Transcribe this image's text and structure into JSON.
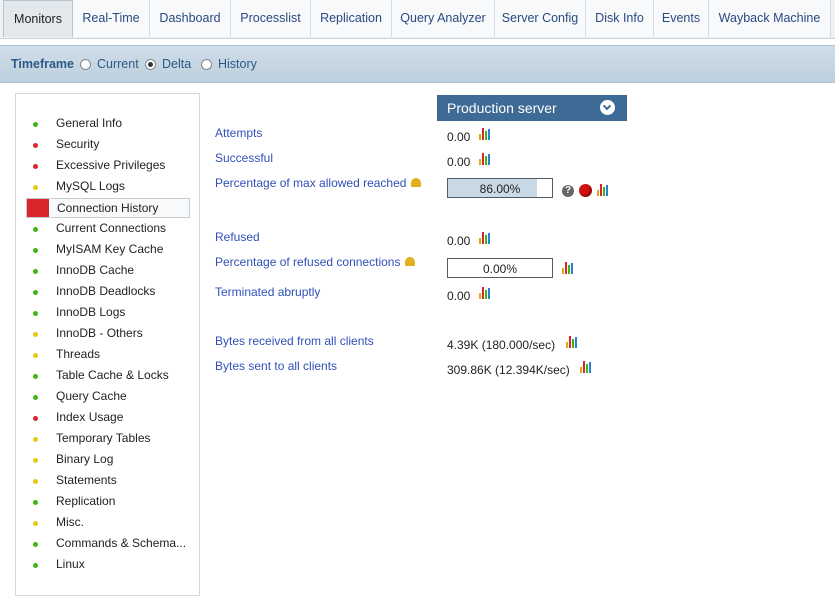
{
  "tabs": [
    "Monitors",
    "Real-Time",
    "Dashboard",
    "Processlist",
    "Replication",
    "Query Analyzer",
    "Server Config",
    "Disk Info",
    "Events",
    "Wayback Machine"
  ],
  "active_tab": "Monitors",
  "timeframe": {
    "label": "Timeframe",
    "options": [
      "Current",
      "Delta",
      "History"
    ],
    "selected": "Delta"
  },
  "sidebar": {
    "items": [
      {
        "label": "General Info",
        "status": "green"
      },
      {
        "label": "Security",
        "status": "red"
      },
      {
        "label": "Excessive Privileges",
        "status": "red"
      },
      {
        "label": "MySQL Logs",
        "status": "yellow"
      },
      {
        "label": "Connection History",
        "status": "red",
        "active": true
      },
      {
        "label": "Current Connections",
        "status": "green"
      },
      {
        "label": "MyISAM Key Cache",
        "status": "green"
      },
      {
        "label": "InnoDB Cache",
        "status": "green"
      },
      {
        "label": "InnoDB Deadlocks",
        "status": "green"
      },
      {
        "label": "InnoDB Logs",
        "status": "green"
      },
      {
        "label": "InnoDB - Others",
        "status": "yellow"
      },
      {
        "label": "Threads",
        "status": "yellow"
      },
      {
        "label": "Table Cache & Locks",
        "status": "green"
      },
      {
        "label": "Query Cache",
        "status": "green"
      },
      {
        "label": "Index Usage",
        "status": "red"
      },
      {
        "label": "Temporary Tables",
        "status": "yellow"
      },
      {
        "label": "Binary Log",
        "status": "yellow"
      },
      {
        "label": "Statements",
        "status": "yellow"
      },
      {
        "label": "Replication",
        "status": "green"
      },
      {
        "label": "Misc.",
        "status": "yellow"
      },
      {
        "label": "Commands & Schema...",
        "status": "green"
      },
      {
        "label": "Linux",
        "status": "green"
      }
    ]
  },
  "status_colors": {
    "green": "#3fb618",
    "red": "#d9262b",
    "yellow": "#e8c81a"
  },
  "server": {
    "name": "Production server"
  },
  "metrics": {
    "attempts": {
      "label": "Attempts",
      "value": "0.00"
    },
    "successful": {
      "label": "Successful",
      "value": "0.00"
    },
    "pct_max": {
      "label": "Percentage of max allowed reached",
      "value": "86.00%",
      "fraction": 0.86
    },
    "refused": {
      "label": "Refused",
      "value": "0.00"
    },
    "pct_refused": {
      "label": "Percentage of refused connections",
      "value": "0.00%",
      "fraction": 0.0
    },
    "terminated": {
      "label": "Terminated abruptly",
      "value": "0.00"
    },
    "bytes_received": {
      "label": "Bytes received from all clients",
      "value": "4.39K (180.000/sec)"
    },
    "bytes_sent": {
      "label": "Bytes sent to all clients",
      "value": "309.86K (12.394K/sec)"
    }
  }
}
